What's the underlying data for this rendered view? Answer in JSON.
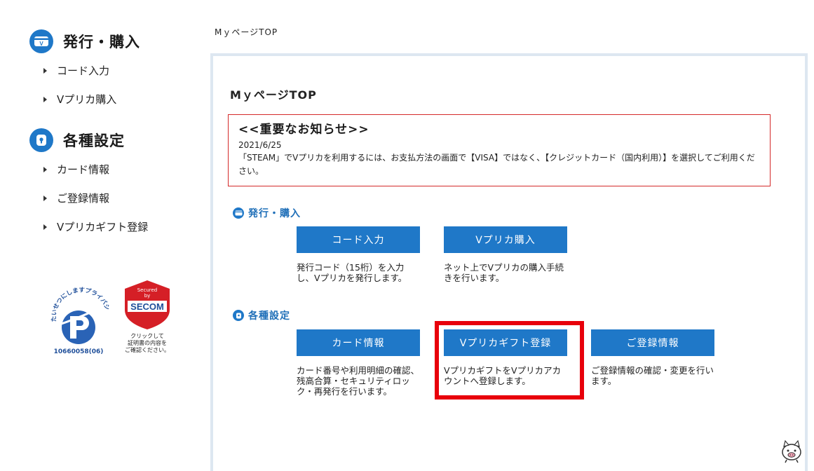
{
  "sidebar": {
    "sections": [
      {
        "title": "発行・購入",
        "icon": "card-v-icon",
        "items": [
          "コード入力",
          "Vプリカ購入"
        ]
      },
      {
        "title": "各種設定",
        "icon": "lock-icon",
        "items": [
          "カード情報",
          "ご登録情報",
          "Vプリカギフト登録"
        ]
      }
    ],
    "privacy_seal_number": "10660058(06)",
    "privacy_seal_text": "たいせつにしますプライバシー",
    "secom_seal_top": "Secured by",
    "secom_seal_brand": "SECOM",
    "secom_seal_caption": "クリックして 証明書の内容を ご確認ください。"
  },
  "breadcrumb": "MｙページTOP",
  "main": {
    "title": "MｙページTOP",
    "notice": {
      "title": "<<重要なお知らせ>>",
      "date": "2021/6/25",
      "body": "「STEAM」でVプリカを利用するには、お支払方法の画面で【VISA】ではなく、【クレジットカード（国内利用）】を選択してご利用ください。"
    },
    "purchase": {
      "heading": "発行・購入",
      "buttons": [
        {
          "label": "コード入力",
          "desc": "発行コード（15桁）を入力し、Vプリカを発行します。"
        },
        {
          "label": "Vプリカ購入",
          "desc": "ネット上でVプリカの購入手続きを行います。"
        }
      ]
    },
    "settings": {
      "heading": "各種設定",
      "buttons": [
        {
          "label": "カード情報",
          "desc": "カード番号や利用明細の確認、残高合算・セキュリティロック・再発行を行います。"
        },
        {
          "label": "Vプリカギフト登録",
          "desc": "VプリカギフトをVプリカアカウントへ登録します。"
        },
        {
          "label": "ご登録情報",
          "desc": "ご登録情報の確認・変更を行います。"
        }
      ]
    }
  },
  "colors": {
    "brand_blue": "#1f78c8",
    "notice_border": "#d42a2a",
    "highlight_red": "#e8000b",
    "panel_border": "#dde7f1"
  }
}
